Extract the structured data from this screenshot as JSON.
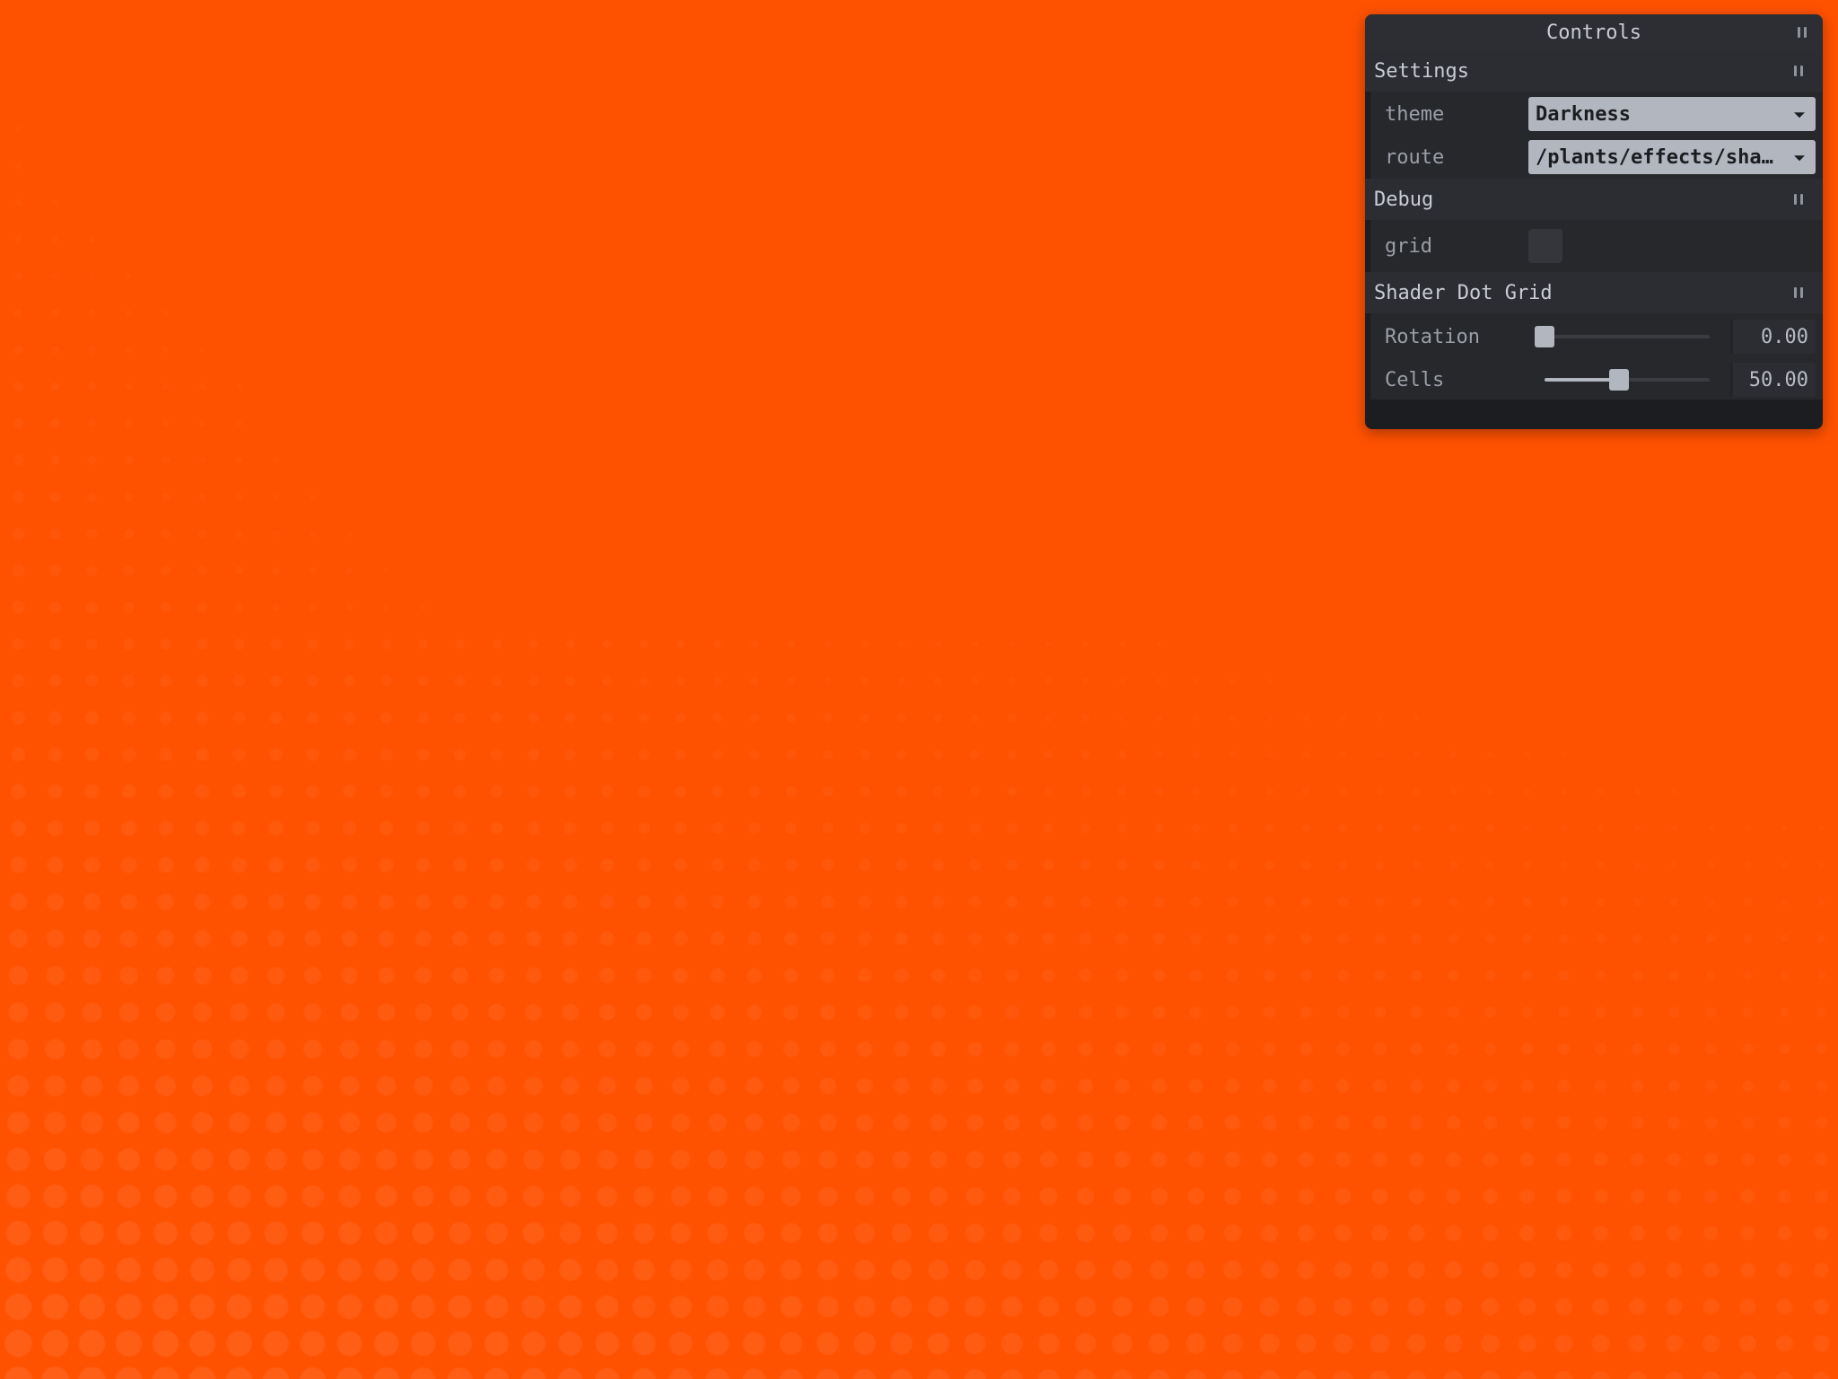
{
  "background": {
    "color": "#ff5200",
    "dot_color": "#ff6a28"
  },
  "panel": {
    "title": "Controls",
    "folders": {
      "settings": {
        "title": "Settings",
        "theme": {
          "label": "theme",
          "value": "Darkness"
        },
        "route": {
          "label": "route",
          "value": "/plants/effects/sha…"
        }
      },
      "debug": {
        "title": "Debug",
        "grid": {
          "label": "grid",
          "checked": false
        }
      },
      "shader": {
        "title": "Shader Dot Grid",
        "rotation": {
          "label": "Rotation",
          "value": "0.00",
          "fraction": 0.0
        },
        "cells": {
          "label": "Cells",
          "value": "50.00",
          "fraction": 0.45
        }
      }
    }
  }
}
